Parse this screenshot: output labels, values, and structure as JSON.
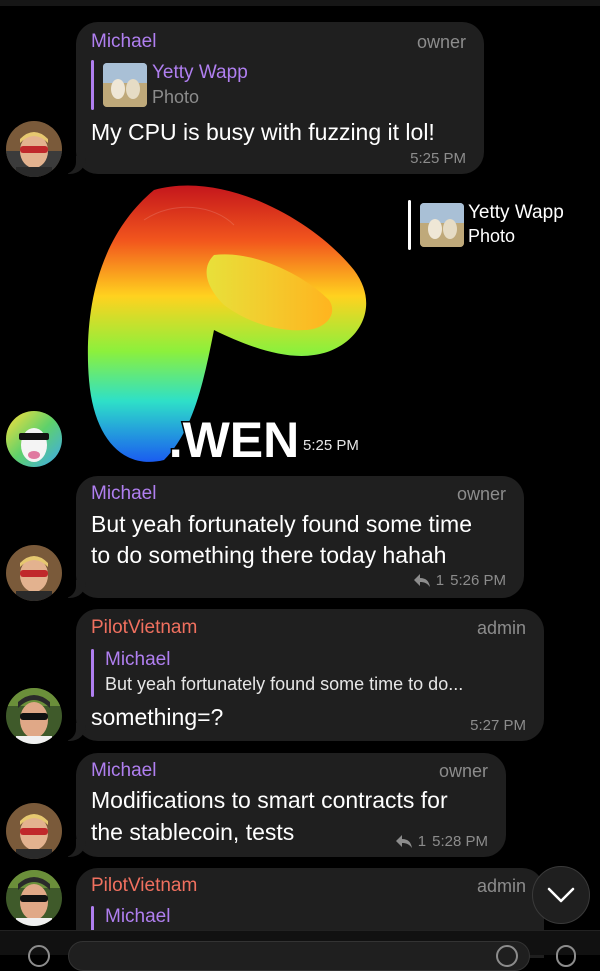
{
  "colors": {
    "michael": "#b07ff0",
    "pilot": "#f0705f",
    "meta": "#8c8c8c",
    "bubble": "#1f1f1f"
  },
  "messages": [
    {
      "sender": "Michael",
      "role": "owner",
      "reply_name": "Yetty Wapp",
      "reply_sub": "Photo",
      "text": "My CPU is busy with fuzzing it lol!",
      "time": "5:25 PM"
    },
    {
      "sticker_text": ".WEN",
      "reply_name": "Yetty Wapp",
      "reply_sub": "Photo",
      "time": "5:25 PM"
    },
    {
      "sender": "Michael",
      "role": "owner",
      "text_lines": [
        "But yeah fortunately found some time",
        "to do something there today hahah"
      ],
      "replies": "1",
      "time": "5:26 PM"
    },
    {
      "sender": "PilotVietnam",
      "role": "admin",
      "reply_name": "Michael",
      "reply_sub": "But yeah fortunately found some time to do...",
      "text": "something=?",
      "time": "5:27 PM"
    },
    {
      "sender": "Michael",
      "role": "owner",
      "text_lines": [
        "Modifications to smart contracts for",
        "the stablecoin, tests"
      ],
      "replies": "1",
      "time": "5:28 PM"
    },
    {
      "sender": "PilotVietnam",
      "role": "admin",
      "reply_name": "Michael"
    }
  ]
}
